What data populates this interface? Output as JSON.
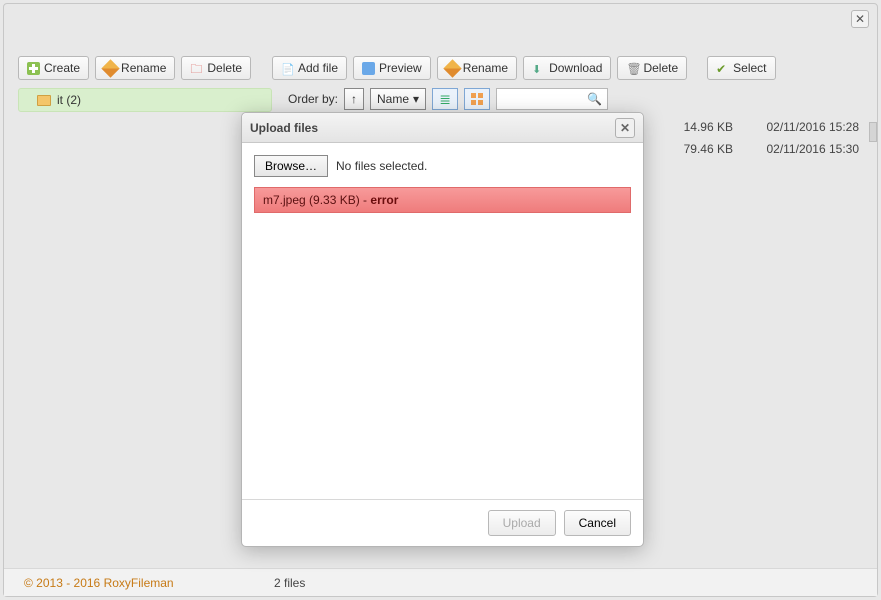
{
  "toolbar_left": {
    "create": "Create",
    "rename": "Rename",
    "delete": "Delete"
  },
  "toolbar_right": {
    "add_file": "Add file",
    "preview": "Preview",
    "rename": "Rename",
    "download": "Download",
    "delete": "Delete",
    "select": "Select"
  },
  "filter": {
    "order_by": "Order by:",
    "sort_dir": "↑",
    "sort_field": "Name"
  },
  "tree": {
    "items": [
      {
        "label": "it (2)"
      }
    ]
  },
  "files": [
    {
      "size": "14.96 KB",
      "date": "02/11/2016 15:28"
    },
    {
      "size": "79.46 KB",
      "date": "02/11/2016 15:30"
    }
  ],
  "footer": {
    "copyright": "© 2013 - 2016 RoxyFileman",
    "count": "2 files"
  },
  "dialog": {
    "title": "Upload files",
    "browse": "Browse…",
    "no_files": "No files selected.",
    "item_name": "m7.jpeg (9.33 KB) - ",
    "item_status": "error",
    "upload": "Upload",
    "cancel": "Cancel"
  }
}
